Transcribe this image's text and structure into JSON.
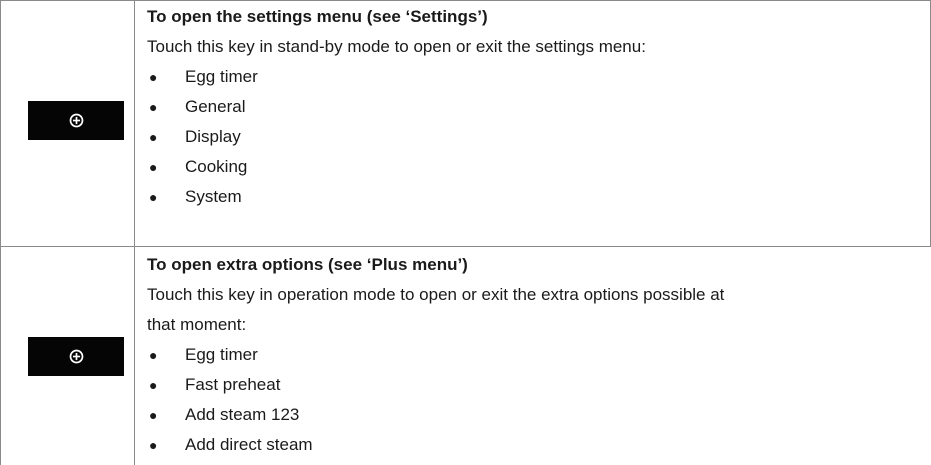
{
  "rows": [
    {
      "key_icon": "plus-circle-icon",
      "heading": "To open the settings menu (see ‘Settings’)",
      "description_lines": [
        "Touch this key in stand-by mode to open or exit the settings menu:"
      ],
      "items": [
        "Egg timer",
        "General",
        "Display",
        "Cooking",
        "System"
      ]
    },
    {
      "key_icon": "plus-circle-icon",
      "heading": "To open extra options (see ‘Plus menu’)",
      "description_lines": [
        "Touch this key in operation mode to open or exit the extra options possible at",
        "that moment:"
      ],
      "items": [
        "Egg timer",
        "Fast preheat",
        "Add steam 123",
        "Add direct steam"
      ]
    }
  ],
  "colors": {
    "key_background": "#050505",
    "key_icon": "#ffffff",
    "rule": "#8a8a8a",
    "text": "#1a1a1a"
  }
}
